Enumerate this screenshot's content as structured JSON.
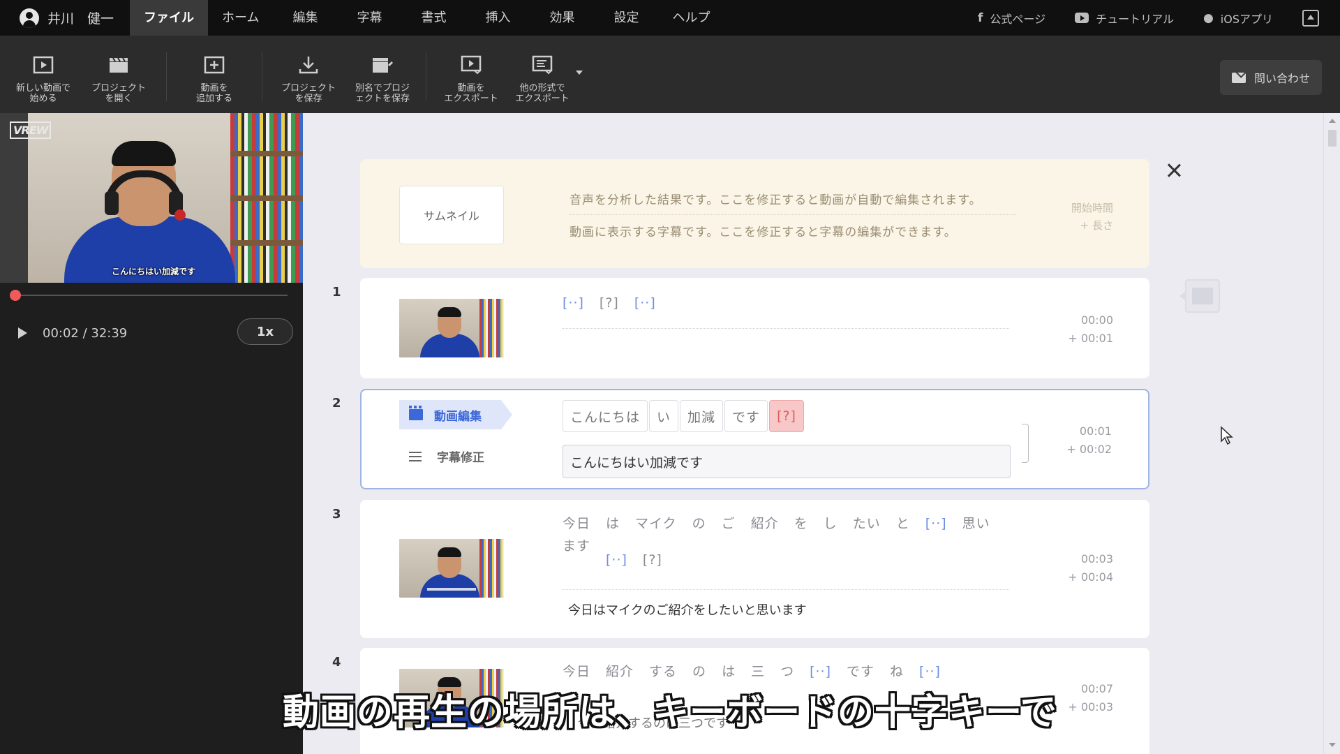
{
  "user": {
    "name": "井川　健一"
  },
  "menu": [
    "ファイル",
    "ホーム",
    "編集",
    "字幕",
    "書式",
    "挿入",
    "効果",
    "設定",
    "ヘルプ"
  ],
  "menu_active": "ファイル",
  "external_links": {
    "official": "公式ページ",
    "tutorial": "チュートリアル",
    "ios": "iOSアプリ"
  },
  "toolbar": {
    "new_video": "新しい動画で\n始める",
    "open_project": "プロジェクト\nを開く",
    "add_video": "動画を\n追加する",
    "save_project": "プロジェクト\nを保存",
    "save_as": "別名でプロジ\nェクトを保存",
    "export_video": "動画を\nエクスポート",
    "export_other": "他の形式で\nエクスポート",
    "contact": "問い合わせ"
  },
  "preview": {
    "watermark": "VREW",
    "caption": "こんにちはい加減です",
    "time": "00:02 / 32:39",
    "speed": "1x",
    "progress": 0.001
  },
  "header": {
    "thumbnail": "サムネイル",
    "line1": "音声を分析した結果です。ここを修正すると動画が自動で編集されます。",
    "line2": "動画に表示する字幕です。ここを修正すると字幕の編集ができます。",
    "meta1": "開始時間",
    "meta2": "+ 長さ"
  },
  "rows": [
    {
      "num": "1",
      "tokens": [
        "[··]",
        "[?]",
        "[··]"
      ],
      "start": "00:00",
      "dur": "+ 00:01",
      "subtitle": ""
    },
    {
      "num": "2",
      "chips": [
        "こんにちは",
        "い",
        "加減",
        "です",
        "[?]"
      ],
      "mode_video": "動画編集",
      "mode_sub": "字幕修正",
      "subtitle": "こんにちはい加減です",
      "start": "00:01",
      "dur": "+ 00:02"
    },
    {
      "num": "3",
      "tokens": [
        "今日",
        "は",
        "マイク",
        "の",
        "ご",
        "紹介",
        "を",
        "し",
        "たい",
        "と",
        "[··]",
        "思い",
        "ます",
        "[··]",
        "[?]"
      ],
      "start": "00:03",
      "dur": "+ 00:04",
      "subtitle": "今日はマイクのご紹介をしたいと思います"
    },
    {
      "num": "4",
      "tokens": [
        "今日",
        "紹介",
        "する",
        "の",
        "は",
        "三",
        "つ",
        "[··]",
        "です",
        "ね",
        "[··]"
      ],
      "start": "00:07",
      "dur": "+ 00:03",
      "subtitle": "今日紹介するのは三つです"
    }
  ],
  "overlay_caption": "動画の再生の場所は、キーボードの十字キーで"
}
